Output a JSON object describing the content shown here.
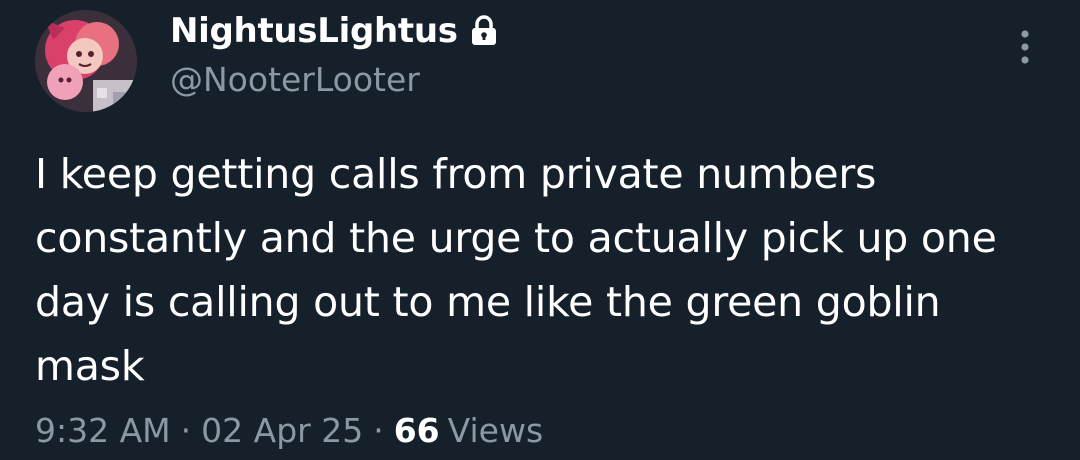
{
  "author": {
    "display_name": "NightusLightus",
    "handle": "@NooterLooter",
    "avatar_icon": "avatar-image",
    "protected_icon": "lock-icon"
  },
  "tweet": {
    "text": "I keep getting calls from private numbers constantly and the urge to actually pick up one day is calling out to me like the green goblin mask"
  },
  "meta": {
    "time": "9:32 AM",
    "separator": "·",
    "date": "02 Apr 25",
    "views_count": "66",
    "views_label": "Views"
  },
  "menu": {
    "more_icon": "more-vertical-icon"
  },
  "colors": {
    "background": "#15202b",
    "primary_text": "#ffffff",
    "secondary_text": "#8b98a5"
  }
}
